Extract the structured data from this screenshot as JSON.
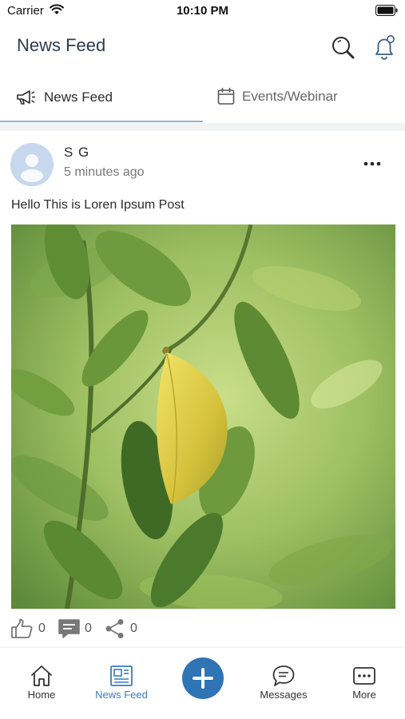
{
  "status_bar": {
    "carrier": "Carrier",
    "time": "10:10 PM"
  },
  "header": {
    "title": "News Feed",
    "icons": [
      "search-icon",
      "bell-icon"
    ]
  },
  "tabs": [
    {
      "label": "News Feed",
      "icon": "megaphone-icon",
      "active": true
    },
    {
      "label": "Events/Webinar",
      "icon": "calendar-icon",
      "active": false
    }
  ],
  "post": {
    "author": "S G",
    "time": "5 minutes ago",
    "text": "Hello This is Loren Ipsum Post",
    "likes": "0",
    "comments": "0",
    "shares": "0"
  },
  "bottom_nav": {
    "items": [
      {
        "label": "Home",
        "icon": "home-icon"
      },
      {
        "label": "News Feed",
        "icon": "newspaper-icon",
        "active": true
      },
      {
        "label": "",
        "icon": "plus-icon"
      },
      {
        "label": "Messages",
        "icon": "chat-icon"
      },
      {
        "label": "More",
        "icon": "more-icon"
      }
    ]
  },
  "colors": {
    "accent": "#2f74b5",
    "active_nav": "#3a7bbd",
    "tab_underline": "#8fb3d6",
    "avatar_bg": "#c7d8ee"
  }
}
